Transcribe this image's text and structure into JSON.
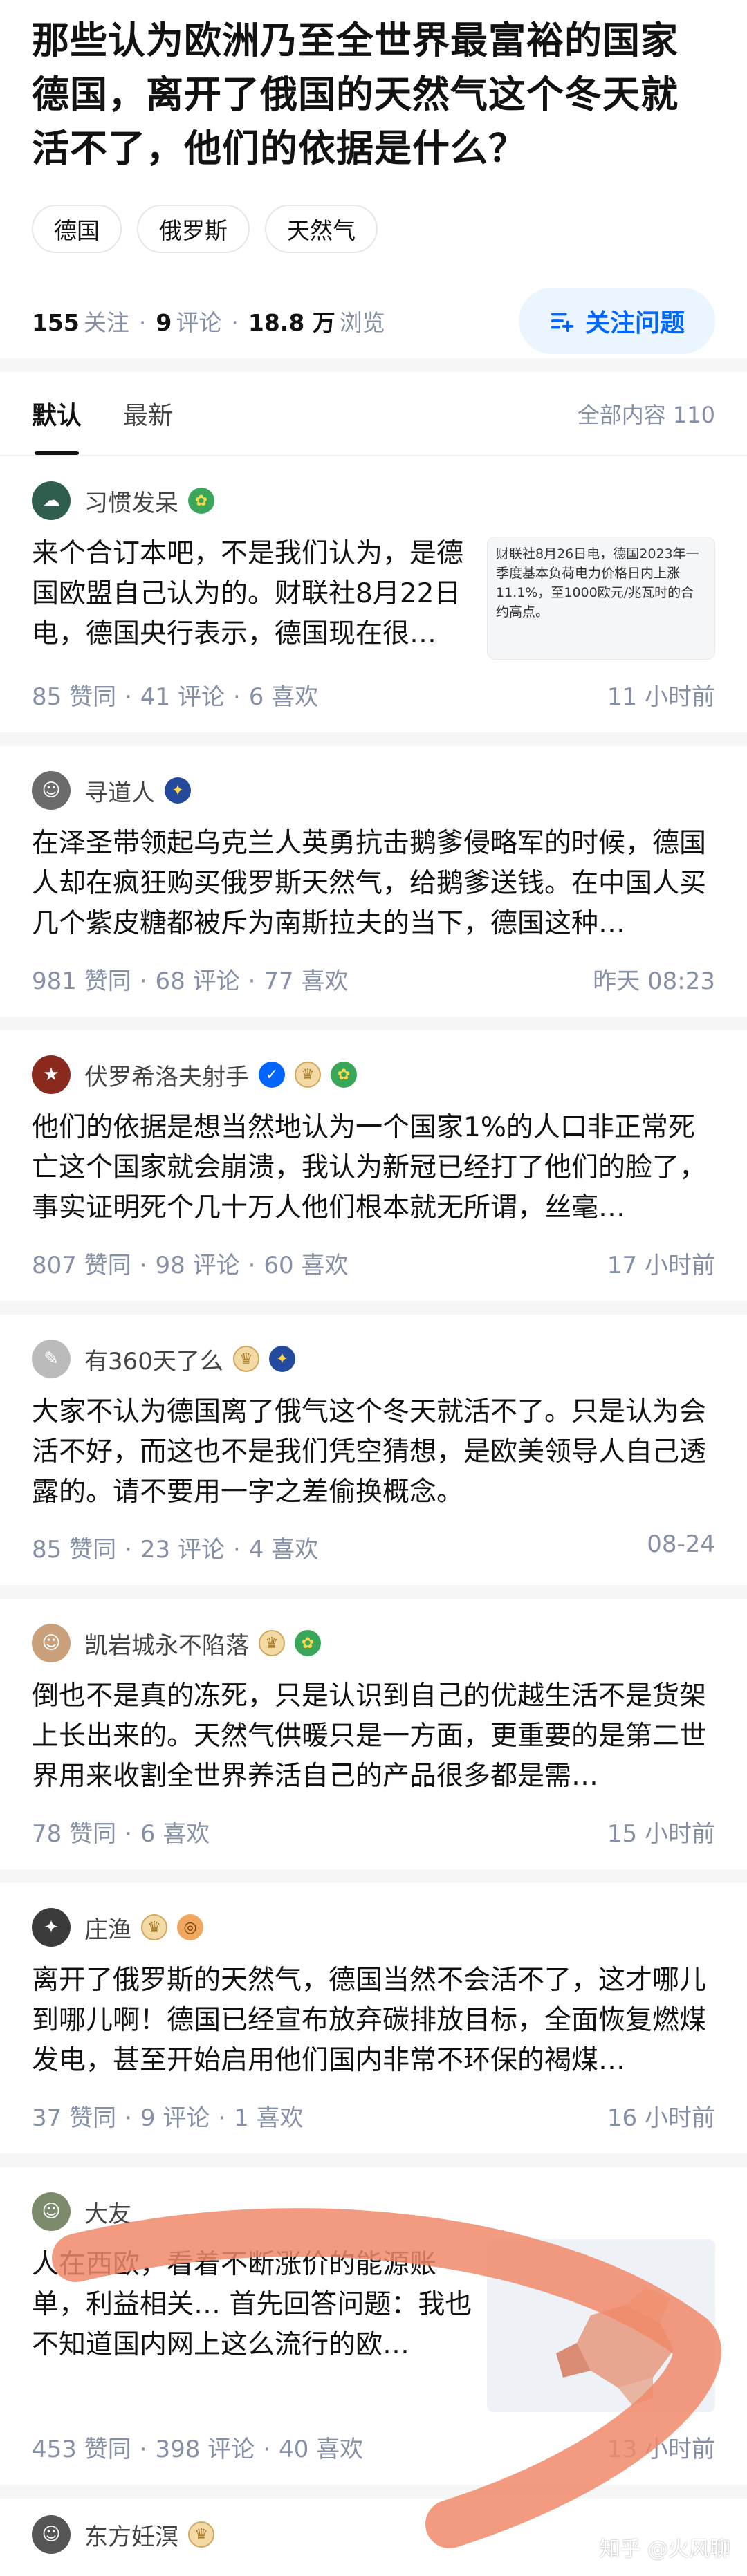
{
  "question": {
    "title": "那些认为欧洲乃至全世界最富裕的国家德国，离开了俄国的天然气这个冬天就活不了，他们的依据是什么？",
    "tags": [
      "德国",
      "俄罗斯",
      "天然气"
    ],
    "followers": "155",
    "followers_label": "关注",
    "comments": "9",
    "comments_label": "评论",
    "views": "18.8 万",
    "views_label": "浏览",
    "follow_button": "关注问题"
  },
  "tabs": {
    "default": "默认",
    "latest": "最新",
    "all_content": "全部内容 110"
  },
  "answers": [
    {
      "author": "习惯发呆",
      "text": "来个合订本吧，不是我们认为，是德国欧盟自己认为的。财联社8月22日电，德国央行表示，德国现在很…",
      "thumb_text": "财联社8月26日电，德国2023年一季度基本负荷电力价格日内上涨11.1%，至1000欧元/兆瓦时的合约高点。",
      "likes": "85",
      "likes_label": "赞同",
      "comments": "41",
      "comments_label": "评论",
      "favs": "6",
      "favs_label": "喜欢",
      "time": "11 小时前"
    },
    {
      "author": "寻道人",
      "text": "在泽圣带领起乌克兰人英勇抗击鹅爹侵略军的时候，德国人却在疯狂购买俄罗斯天然气，给鹅爹送钱。在中国人买几个紫皮糖都被斥为南斯拉夫的当下，德国这种…",
      "likes": "981",
      "likes_label": "赞同",
      "comments": "68",
      "comments_label": "评论",
      "favs": "77",
      "favs_label": "喜欢",
      "time": "昨天 08:23"
    },
    {
      "author": "伏罗希洛夫射手",
      "text": "他们的依据是想当然地认为一个国家1%的人口非正常死亡这个国家就会崩溃，我认为新冠已经打了他们的脸了，事实证明死个几十万人他们根本就无所谓，丝毫…",
      "likes": "807",
      "likes_label": "赞同",
      "comments": "98",
      "comments_label": "评论",
      "favs": "60",
      "favs_label": "喜欢",
      "time": "17 小时前"
    },
    {
      "author": "有360天了么",
      "text": "大家不认为德国离了俄气这个冬天就活不了。只是认为会活不好，而这也不是我们凭空猜想，是欧美领导人自己透露的。请不要用一字之差偷换概念。",
      "likes": "85",
      "likes_label": "赞同",
      "comments": "23",
      "comments_label": "评论",
      "favs": "4",
      "favs_label": "喜欢",
      "time": "08-24"
    },
    {
      "author": "凯岩城永不陷落",
      "text": "倒也不是真的冻死，只是认识到自己的优越生活不是货架上长出来的。天然气供暖只是一方面，更重要的是第二世界用来收割全世界养活自己的产品很多都是需…",
      "likes": "78",
      "likes_label": "赞同",
      "favs": "6",
      "favs_label": "喜欢",
      "time": "15 小时前"
    },
    {
      "author": "庄渔",
      "text": "离开了俄罗斯的天然气，德国当然不会活不了，这才哪儿到哪儿啊！德国已经宣布放弃碳排放目标，全面恢复燃煤发电，甚至开始启用他们国内非常不环保的褐煤…",
      "likes": "37",
      "likes_label": "赞同",
      "comments": "9",
      "comments_label": "评论",
      "favs": "1",
      "favs_label": "喜欢",
      "time": "16 小时前"
    },
    {
      "author": "大友",
      "text": "人在西欧，看着不断涨价的能源账单，利益相关… 首先回答问题：我也不知道国内网上这么流行的欧…",
      "likes": "453",
      "likes_label": "赞同",
      "comments": "398",
      "comments_label": "评论",
      "favs": "40",
      "favs_label": "喜欢",
      "time": "13 小时前"
    }
  ],
  "next_author": "东方妊溟",
  "watermark": "知乎 @火风聊",
  "colors": {
    "accent": "#0066ff",
    "swoosh": "#f08a6a"
  }
}
